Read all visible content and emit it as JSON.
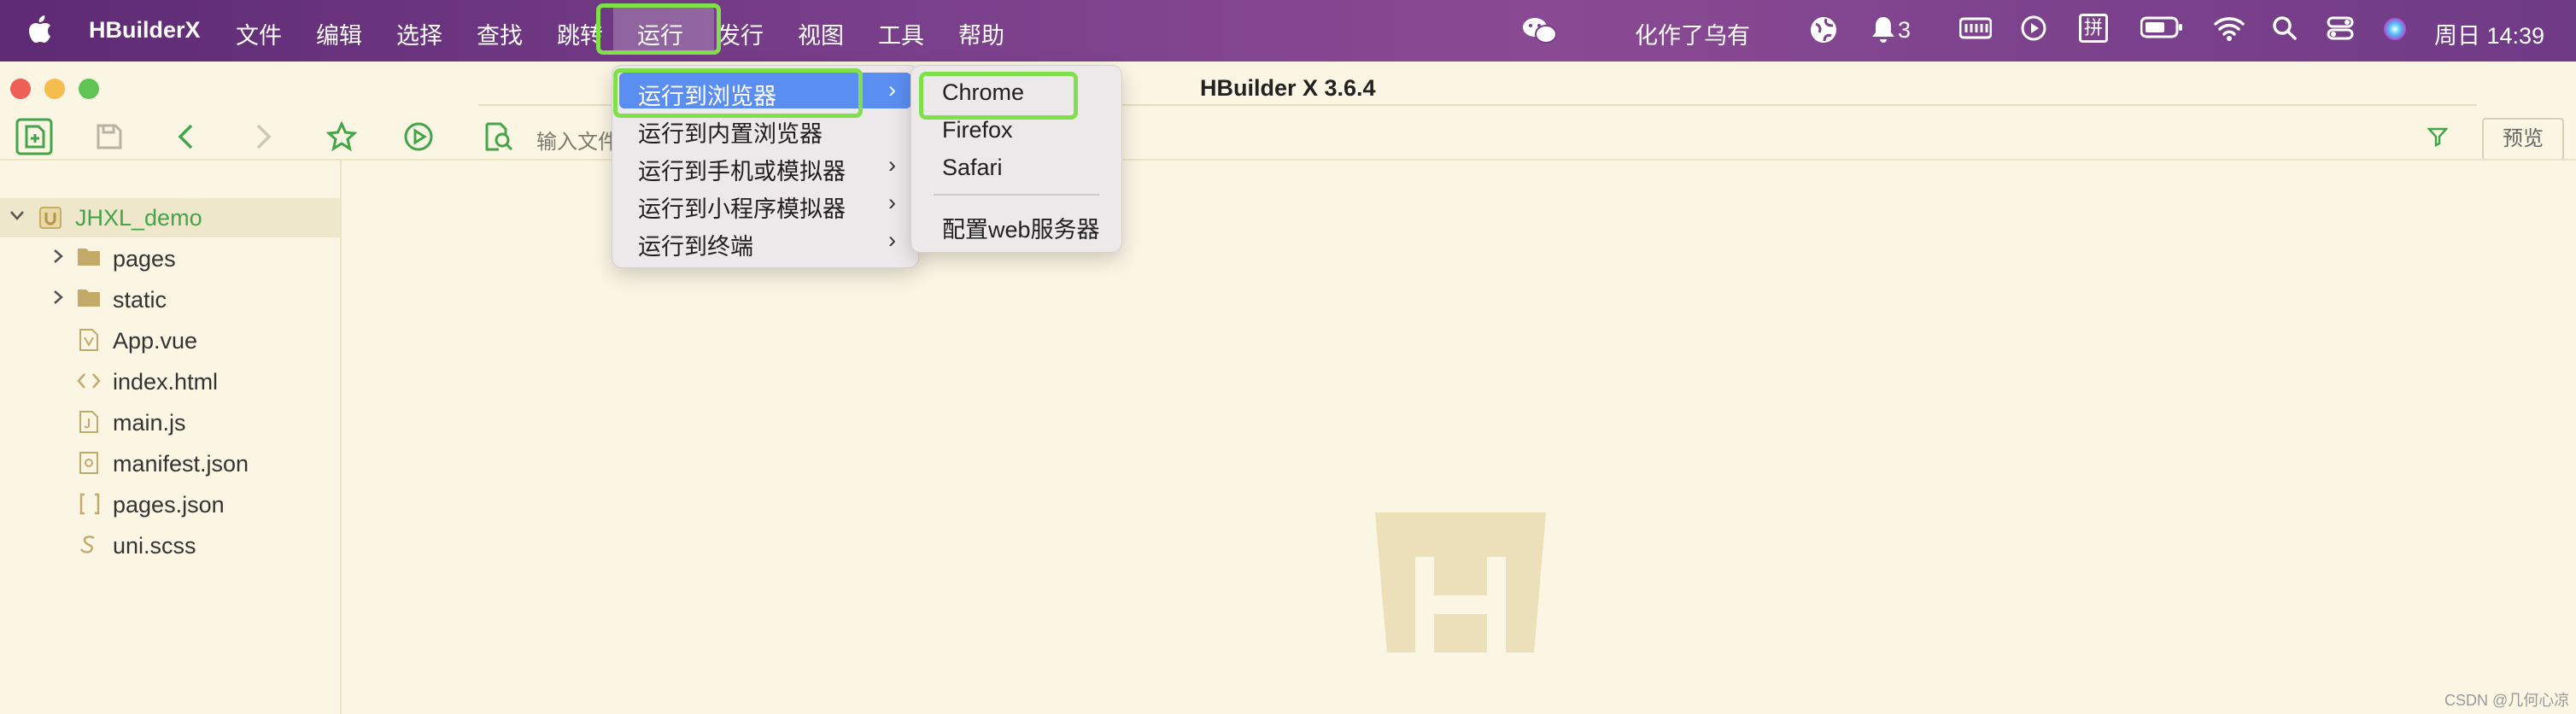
{
  "menubar": {
    "app_name": "HBuilderX",
    "items": [
      "文件",
      "编辑",
      "选择",
      "查找",
      "跳转",
      "运行",
      "发行",
      "视图",
      "工具",
      "帮助"
    ],
    "status_text": "化作了乌有",
    "notification_count": "3",
    "ime_label": "拼",
    "clock": "周日 14:39"
  },
  "window": {
    "title": "HBuilder X 3.6.4",
    "search_placeholder": "输入文件",
    "preview_label": "预览"
  },
  "sidebar": {
    "project": "JHXL_demo",
    "items": [
      {
        "label": "pages",
        "type": "folder"
      },
      {
        "label": "static",
        "type": "folder"
      },
      {
        "label": "App.vue",
        "type": "vue"
      },
      {
        "label": "index.html",
        "type": "html"
      },
      {
        "label": "main.js",
        "type": "js"
      },
      {
        "label": "manifest.json",
        "type": "manifest"
      },
      {
        "label": "pages.json",
        "type": "json"
      },
      {
        "label": "uni.scss",
        "type": "scss"
      }
    ]
  },
  "run_menu": {
    "items": [
      "运行到浏览器",
      "运行到内置浏览器",
      "运行到手机或模拟器",
      "运行到小程序模拟器",
      "运行到终端"
    ]
  },
  "browser_submenu": {
    "items": [
      "Chrome",
      "Firefox",
      "Safari"
    ],
    "config_label": "配置web服务器"
  },
  "watermark": "CSDN @几何心凉",
  "colors": {
    "accent_green": "#43a547",
    "highlight_box": "#7fe04a",
    "menu_highlight": "#5a8ef0",
    "menubar_purple": "#7a3f8b",
    "editor_bg": "#fbf6e4"
  }
}
